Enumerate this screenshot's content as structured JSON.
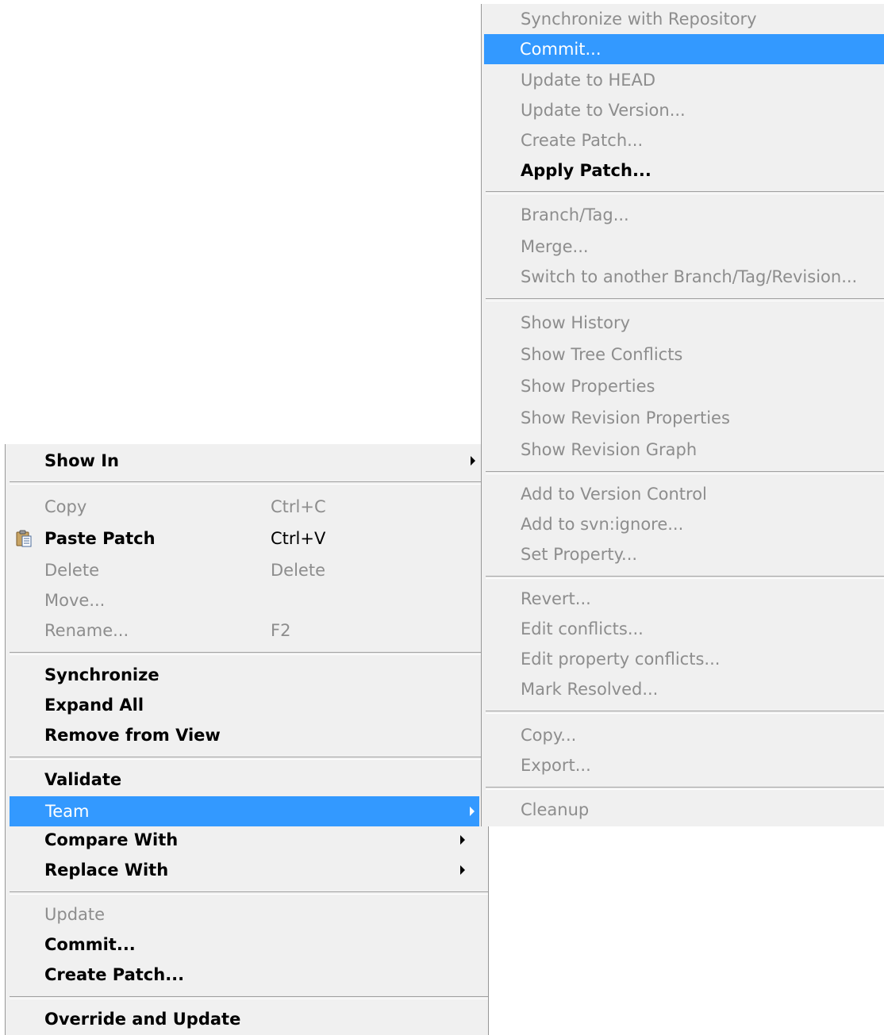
{
  "left_menu": {
    "show_in": "Show In",
    "copy": "Copy",
    "copy_shortcut": "Ctrl+C",
    "paste_patch": "Paste Patch",
    "paste_shortcut": "Ctrl+V",
    "delete": "Delete",
    "delete_shortcut": "Delete",
    "move": "Move...",
    "rename": "Rename...",
    "rename_shortcut": "F2",
    "synchronize": "Synchronize",
    "expand_all": "Expand All",
    "remove_from_view": "Remove from View",
    "validate": "Validate",
    "team": "Team",
    "compare_with": "Compare With",
    "replace_with": "Replace With",
    "update": "Update",
    "commit": "Commit...",
    "create_patch": "Create Patch...",
    "override_and_update": "Override and Update"
  },
  "team_submenu": {
    "synchronize_with_repository": "Synchronize with Repository",
    "commit": "Commit...",
    "update_to_head": "Update to HEAD",
    "update_to_version": "Update to Version...",
    "create_patch": "Create Patch...",
    "apply_patch": "Apply Patch...",
    "branch_tag": "Branch/Tag...",
    "merge": "Merge...",
    "switch": "Switch to another Branch/Tag/Revision...",
    "show_history": "Show History",
    "show_tree_conflicts": "Show Tree Conflicts",
    "show_properties": "Show Properties",
    "show_revision_properties": "Show Revision Properties",
    "show_revision_graph": "Show Revision Graph",
    "add_to_version_control": "Add to Version Control",
    "add_to_svnignore": "Add to svn:ignore...",
    "set_property": "Set Property...",
    "revert": "Revert...",
    "edit_conflicts": "Edit conflicts...",
    "edit_property_conflicts": "Edit property conflicts...",
    "mark_resolved": "Mark Resolved...",
    "copy": "Copy...",
    "export": "Export...",
    "cleanup": "Cleanup"
  },
  "colors": {
    "menu_bg": "#f0f0f0",
    "highlight": "#3399ff",
    "disabled_text": "#8d8d8d"
  },
  "icons": {
    "paste_patch": "clipboard-icon"
  }
}
